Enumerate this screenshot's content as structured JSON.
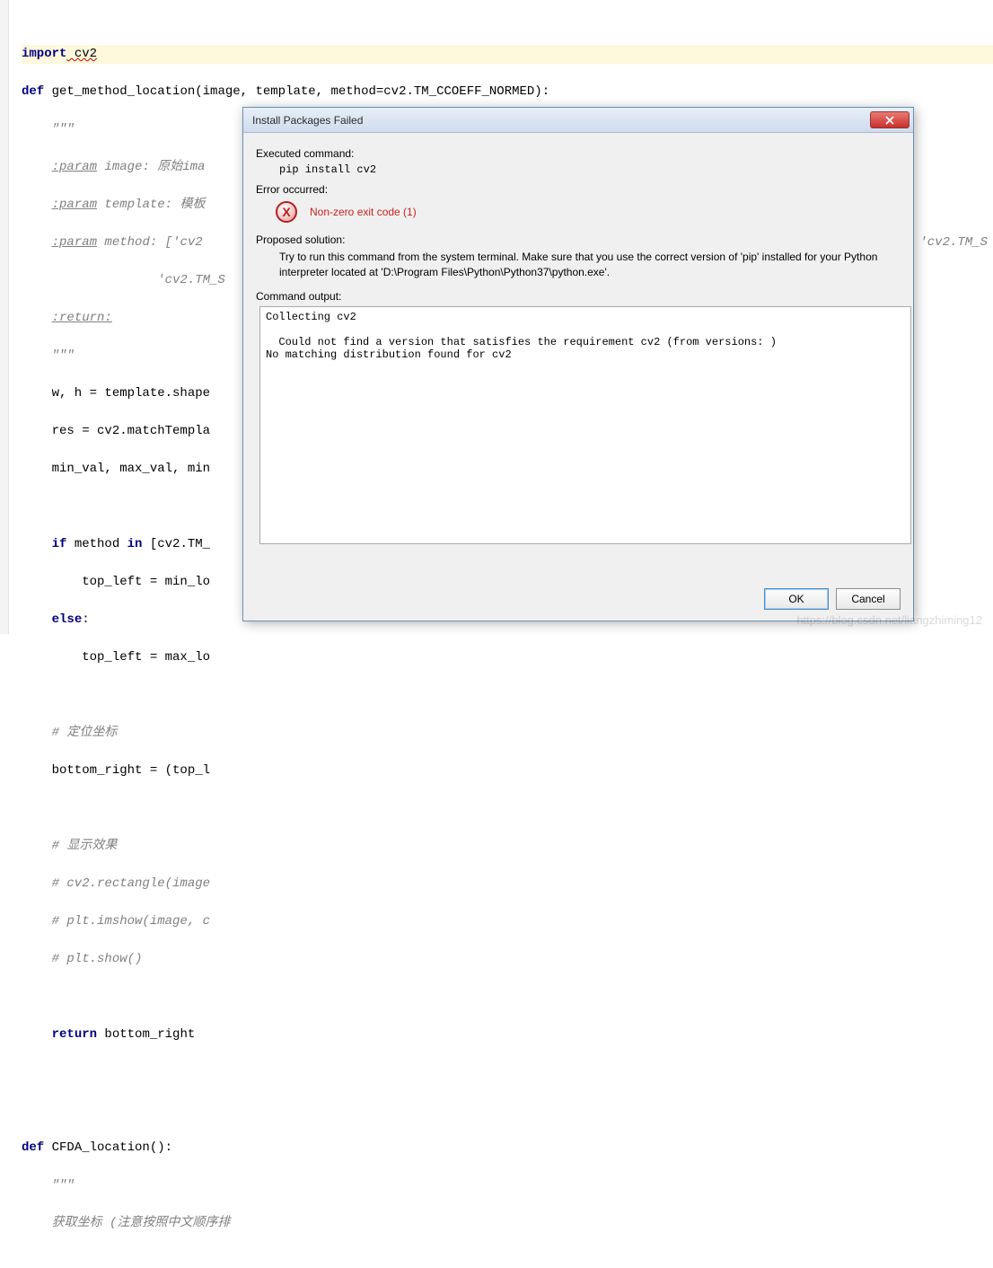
{
  "code": {
    "l1a": "import",
    "l1b": " cv2",
    "l3a": "def",
    "l3b": " get_method_location(image, template, method=cv2.TM_CCOEFF_NORMED):",
    "l4": "    \"\"\"",
    "l5a": "    ",
    "l5p": ":param",
    "l5b": " image: 原始ima",
    "l6a": "    ",
    "l6p": ":param",
    "l6b": " template: 模板",
    "l7a": "    ",
    "l7p": ":param",
    "l7b": " method: ['cv2",
    "l7t": "'cv2.TM_S",
    "l8": "                  'cv2.TM_S",
    "l9a": "    ",
    "l9p": ":return:",
    "l10": "    \"\"\"",
    "l11": "    w, h = template.shape",
    "l12": "    res = cv2.matchTempla",
    "l13": "    min_val, max_val, min",
    "l15a": "    ",
    "l15k": "if",
    "l15b": " method ",
    "l15k2": "in",
    "l15c": " [cv2.TM_",
    "l16": "        top_left = min_lo",
    "l17a": "    ",
    "l17k": "else",
    "l17b": ":",
    "l18": "        top_left = max_lo",
    "l20": "    # 定位坐标",
    "l21": "    bottom_right = (top_l",
    "l23": "    # 显示效果",
    "l24": "    # cv2.rectangle(image",
    "l25": "    # plt.imshow(image, c",
    "l26": "    # plt.show()",
    "l28a": "    ",
    "l28k": "return",
    "l28b": " bottom_right",
    "l31a": "def",
    "l31b": " CFDA_location():",
    "l32": "    \"\"\"",
    "l33": "    获取坐标 (注意按照中文顺序排"
  },
  "dialog": {
    "title": "Install Packages Failed",
    "executed_label": "Executed command:",
    "executed_cmd": "pip install cv2",
    "error_label": "Error occurred:",
    "error_text": "Non-zero exit code (1)",
    "solution_label": "Proposed solution:",
    "solution_text": "Try to run this command from the system terminal. Make sure that you use the correct version of 'pip' installed for your Python interpreter located at 'D:\\Program Files\\Python\\Python37\\python.exe'.",
    "output_label": "Command output:",
    "output_text": "Collecting cv2\n\n  Could not find a version that satisfies the requirement cv2 (from versions: )\nNo matching distribution found for cv2",
    "ok": "OK",
    "cancel": "Cancel"
  },
  "watermark": "https://blog.csdn.net/liangzhiming12"
}
